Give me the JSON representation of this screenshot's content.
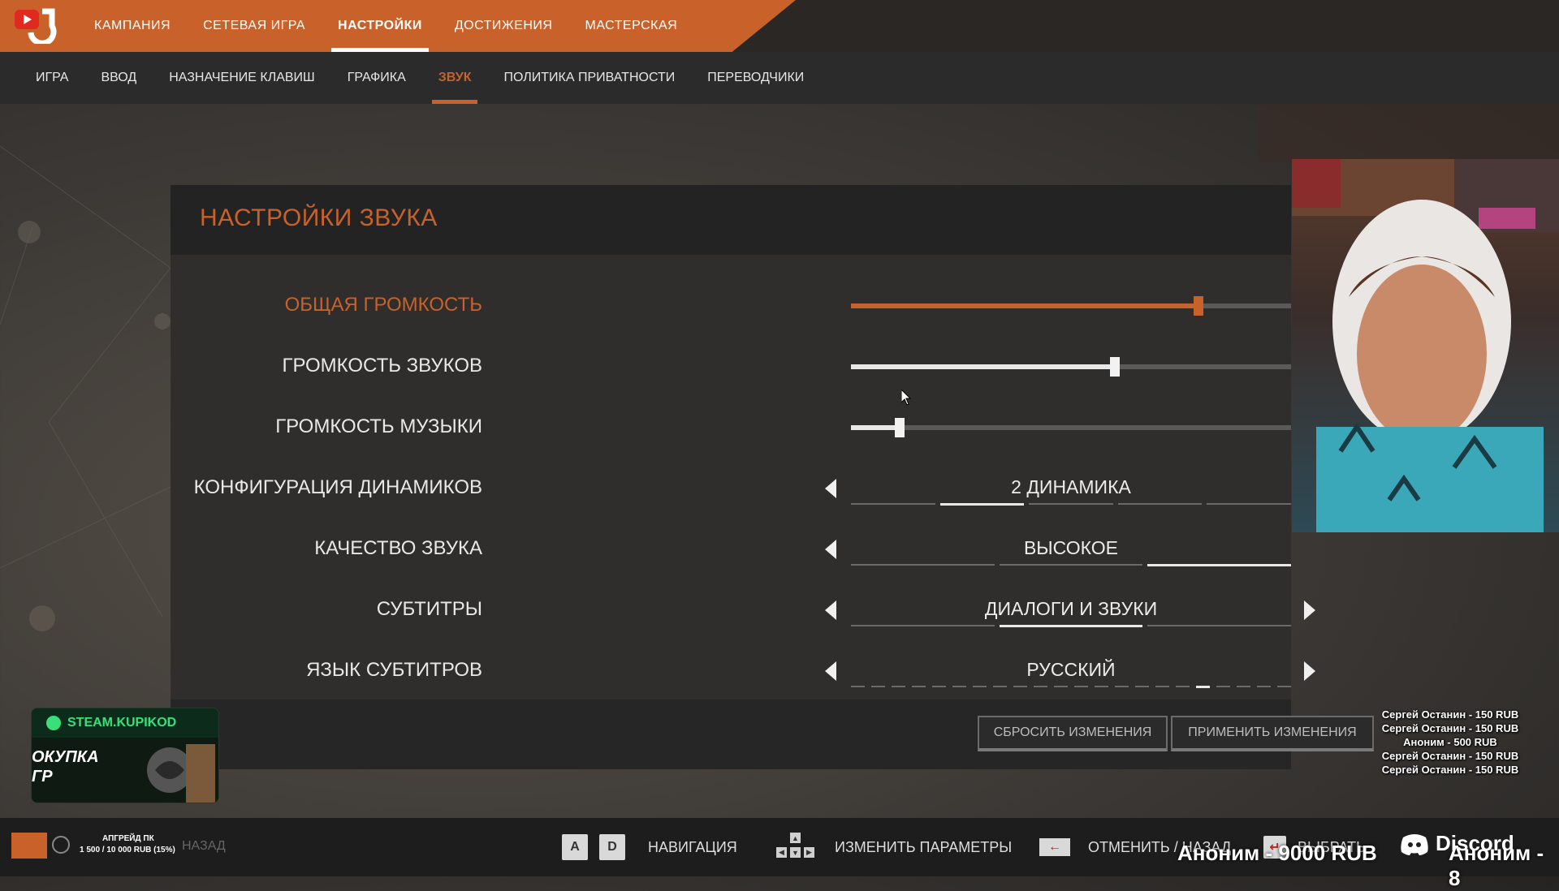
{
  "top_nav": {
    "items": [
      {
        "label": "КАМПАНИЯ"
      },
      {
        "label": "СЕТЕВАЯ ИГРА"
      },
      {
        "label": "НАСТРОЙКИ"
      },
      {
        "label": "ДОСТИЖЕНИЯ"
      },
      {
        "label": "МАСТЕРСКАЯ"
      }
    ],
    "active_index": 2
  },
  "sub_nav": {
    "items": [
      {
        "label": "ИГРА"
      },
      {
        "label": "ВВОД"
      },
      {
        "label": "НАЗНАЧЕНИЕ КЛАВИШ"
      },
      {
        "label": "ГРАФИКА"
      },
      {
        "label": "ЗВУК"
      },
      {
        "label": "ПОЛИТИКА ПРИВАТНОСТИ"
      },
      {
        "label": "ПЕРЕВОДЧИКИ"
      }
    ],
    "active_index": 4
  },
  "panel": {
    "title": "НАСТРОЙКИ ЗВУКА",
    "settings": {
      "master_volume": {
        "label": "ОБЩАЯ ГРОМКОСТЬ",
        "value_fraction": 0.79
      },
      "sfx_volume": {
        "label": "ГРОМКОСТЬ ЗВУКОВ",
        "value_fraction": 0.6
      },
      "music_volume": {
        "label": "ГРОМКОСТЬ МУЗЫКИ",
        "value_fraction": 0.11
      },
      "speaker_config": {
        "label": "КОНФИГУРАЦИЯ ДИНАМИКОВ",
        "value": "2 ДИНАМИКА",
        "segments": 5,
        "selected_segment": 1
      },
      "sound_quality": {
        "label": "КАЧЕСТВО ЗВУКА",
        "value": "ВЫСОКОЕ",
        "segments": 3,
        "selected_segment": 2
      },
      "subtitles": {
        "label": "СУБТИТРЫ",
        "value": "ДИАЛОГИ И ЗВУКИ",
        "segments": 3,
        "selected_segment": 1
      },
      "subtitle_language": {
        "label": "ЯЗЫК СУБТИТРОВ",
        "value": "РУССКИЙ",
        "segments": 22,
        "selected_segment": 17
      }
    },
    "buttons": {
      "reset": "СБРОСИТЬ ИЗМЕНЕНИЯ",
      "apply": "ПРИМЕНИТЬ ИЗМЕНЕНИЯ"
    }
  },
  "bottom_hints": {
    "nav_keys": [
      "A",
      "D"
    ],
    "nav_label": "НАВИГАЦИЯ",
    "change_label": "ИЗМЕНИТЬ ПАРАМЕТРЫ",
    "cancel_label": "ОТМЕНИТЬ / НАЗАД",
    "select_label": "ВЫБРАТЬ"
  },
  "overlay": {
    "ad_brand": "STEAM.KUPIKOD",
    "ad_text_1": "ОКУПКА",
    "ad_text_2": "ГР",
    "upgrade_title": "АПГРЕЙД ПК",
    "upgrade_progress": "1 500 / 10 000 RUB (15%)",
    "upgrade_fraction": 0.15,
    "back_ghost": "НАЗАД",
    "donations": [
      "Сергей Останин - 150 RUB",
      "Сергей Останин - 150 RUB",
      "Аноним - 500 RUB",
      "Сергей Останин - 150 RUB",
      "Сергей Останин - 150 RUB"
    ],
    "ticker_1": "Аноним - 9000 RUB",
    "ticker_2": "Аноним - 8",
    "discord_label": "Discord"
  },
  "colors": {
    "accent": "#c8612a",
    "text": "#e6e6e6",
    "ad_green": "#39e07a"
  }
}
